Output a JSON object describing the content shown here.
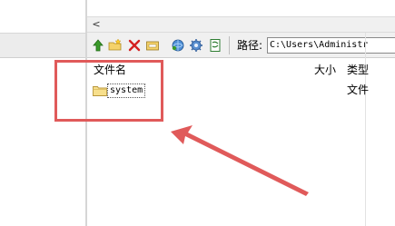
{
  "scrollbar": {
    "left_arrow": "<"
  },
  "toolbar": {
    "icons": [
      "up-arrow-icon",
      "new-folder-icon",
      "delete-icon",
      "folder-open-icon",
      "refresh-icon",
      "settings-icon",
      "document-icon"
    ],
    "path_label": "路径:",
    "path_value": "C:\\Users\\Administr"
  },
  "file_list": {
    "headers": {
      "name": "文件名",
      "size": "大小",
      "type": "类型"
    },
    "rows": [
      {
        "name": "system",
        "size": "",
        "type": "文件"
      }
    ]
  },
  "annotation": {
    "color": "#e05a5a"
  }
}
